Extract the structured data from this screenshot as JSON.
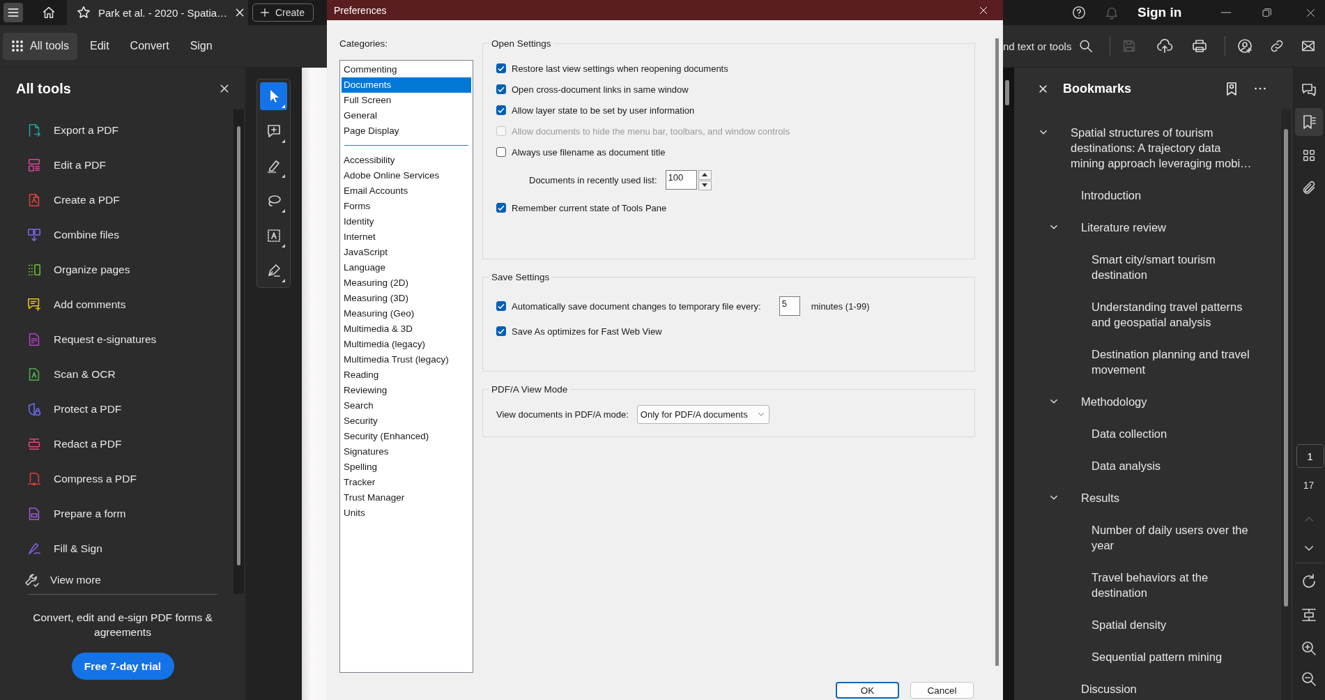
{
  "app": {
    "document_tab": {
      "title": "Park et al. - 2020 - Spatia…"
    },
    "create_button": "Create",
    "sign_in": "Sign in"
  },
  "toolbar": {
    "tabs": [
      {
        "label": "All tools",
        "selected": true
      },
      {
        "label": "Edit",
        "selected": false
      },
      {
        "label": "Convert",
        "selected": false
      },
      {
        "label": "Sign",
        "selected": false
      }
    ],
    "search_text": "nd text or tools"
  },
  "all_tools": {
    "title": "All tools",
    "tools": [
      {
        "label": "Export a PDF",
        "color": "#1fa39b"
      },
      {
        "label": "Edit a PDF",
        "color": "#e2449a"
      },
      {
        "label": "Create a PDF",
        "color": "#e1403c"
      },
      {
        "label": "Combine files",
        "color": "#7b6cf0"
      },
      {
        "label": "Organize pages",
        "color": "#6cbf34"
      },
      {
        "label": "Add comments",
        "color": "#e8c21a"
      },
      {
        "label": "Request e-signatures",
        "color": "#b440c8"
      },
      {
        "label": "Scan & OCR",
        "color": "#4cae4c"
      },
      {
        "label": "Protect a PDF",
        "color": "#6a6cf2"
      },
      {
        "label": "Redact a PDF",
        "color": "#e6437a"
      },
      {
        "label": "Compress a PDF",
        "color": "#df3f3f"
      },
      {
        "label": "Prepare a form",
        "color": "#9b5cd8"
      },
      {
        "label": "Fill & Sign",
        "color": "#8a5ee0"
      }
    ],
    "view_more": "View more",
    "promo": "Convert, edit and e-sign PDF forms & agreements",
    "trial_button": "Free 7-day trial"
  },
  "quick_tools": [
    {
      "kind": "select",
      "selected": true
    },
    {
      "kind": "comment",
      "selected": false
    },
    {
      "kind": "highlight",
      "selected": false
    },
    {
      "kind": "lasso",
      "selected": false
    },
    {
      "kind": "text",
      "selected": false
    },
    {
      "kind": "sign",
      "selected": false
    }
  ],
  "dialog": {
    "title": "Preferences",
    "categories_label": "Categories:",
    "pinned_categories": [
      {
        "label": "Commenting",
        "selected": false
      },
      {
        "label": "Documents",
        "selected": true
      },
      {
        "label": "Full Screen",
        "selected": false
      },
      {
        "label": "General",
        "selected": false
      },
      {
        "label": "Page Display",
        "selected": false
      }
    ],
    "categories": [
      {
        "label": "Accessibility",
        "selected": false
      },
      {
        "label": "Adobe Online Services",
        "selected": false
      },
      {
        "label": "Email Accounts",
        "selected": false
      },
      {
        "label": "Forms",
        "selected": false
      },
      {
        "label": "Identity",
        "selected": false
      },
      {
        "label": "Internet",
        "selected": false
      },
      {
        "label": "JavaScript",
        "selected": false
      },
      {
        "label": "Language",
        "selected": false
      },
      {
        "label": "Measuring (2D)",
        "selected": false
      },
      {
        "label": "Measuring (3D)",
        "selected": false
      },
      {
        "label": "Measuring (Geo)",
        "selected": false
      },
      {
        "label": "Multimedia & 3D",
        "selected": false
      },
      {
        "label": "Multimedia (legacy)",
        "selected": false
      },
      {
        "label": "Multimedia Trust (legacy)",
        "selected": false
      },
      {
        "label": "Reading",
        "selected": false
      },
      {
        "label": "Reviewing",
        "selected": false
      },
      {
        "label": "Search",
        "selected": false
      },
      {
        "label": "Security",
        "selected": false
      },
      {
        "label": "Security (Enhanced)",
        "selected": false
      },
      {
        "label": "Signatures",
        "selected": false
      },
      {
        "label": "Spelling",
        "selected": false
      },
      {
        "label": "Tracker",
        "selected": false
      },
      {
        "label": "Trust Manager",
        "selected": false
      },
      {
        "label": "Units",
        "selected": false
      }
    ],
    "groups": [
      {
        "title": "Open Settings",
        "rows": [
          {
            "kind": "checkbox",
            "label": "Restore last view settings when reopening documents",
            "checked": true,
            "disabled": false
          },
          {
            "kind": "checkbox",
            "label": "Open cross-document links in same window",
            "checked": true,
            "disabled": false
          },
          {
            "kind": "checkbox",
            "label": "Allow layer state to be set by user information",
            "checked": true,
            "disabled": false
          },
          {
            "kind": "checkbox",
            "label": "Allow documents to hide the menu bar, toolbars, and window controls",
            "checked": false,
            "disabled": true
          },
          {
            "kind": "checkbox",
            "label": "Always use filename as document title",
            "checked": false,
            "disabled": false
          },
          {
            "kind": "spin",
            "label": "Documents in recently used list:",
            "value": "100"
          },
          {
            "kind": "checkbox",
            "label": "Remember current state of Tools Pane",
            "checked": true,
            "disabled": false
          }
        ]
      },
      {
        "title": "Save Settings",
        "rows": [
          {
            "kind": "checkbox_field",
            "label": "Automatically save document changes to temporary file every:",
            "checked": true,
            "disabled": false,
            "value": "5",
            "suffix": "minutes (1-99)"
          },
          {
            "kind": "checkbox",
            "label": "Save As optimizes for Fast Web View",
            "checked": true,
            "disabled": false
          }
        ]
      },
      {
        "title": "PDF/A View Mode",
        "rows": [
          {
            "kind": "select",
            "label": "View documents in PDF/A mode:",
            "value": "Only for PDF/A documents"
          }
        ]
      }
    ],
    "buttons": [
      {
        "label": "OK",
        "default": true
      },
      {
        "label": "Cancel",
        "default": false
      }
    ]
  },
  "bookmarks": {
    "title": "Bookmarks",
    "items": [
      {
        "label": "Spatial structures of tourism destinations: A trajectory data mining approach leveraging mobi…",
        "expanded": true,
        "children": [
          {
            "label": "Introduction"
          },
          {
            "label": "Literature review",
            "expanded": true,
            "children": [
              {
                "label": "Smart city/smart tourism destination"
              },
              {
                "label": "Understanding travel patterns and geospatial analysis"
              },
              {
                "label": "Destination planning and travel movement"
              }
            ]
          },
          {
            "label": "Methodology",
            "expanded": true,
            "children": [
              {
                "label": "Data collection"
              },
              {
                "label": "Data analysis"
              }
            ]
          },
          {
            "label": "Results",
            "expanded": true,
            "children": [
              {
                "label": "Number of daily users over the year"
              },
              {
                "label": "Travel behaviors at the destination"
              },
              {
                "label": "Spatial density"
              },
              {
                "label": "Sequential pattern mining"
              }
            ]
          },
          {
            "label": "Discussion"
          }
        ]
      }
    ]
  },
  "page_nav": {
    "current": "1",
    "total": "17"
  }
}
